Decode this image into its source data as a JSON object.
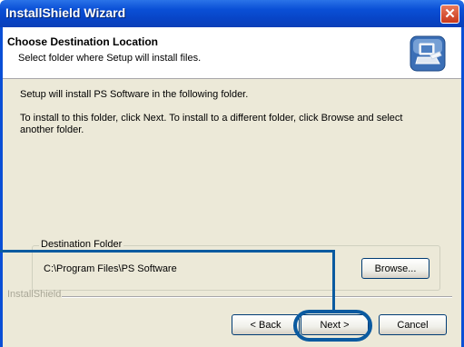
{
  "window": {
    "title": "InstallShield Wizard",
    "close_icon": "close-icon"
  },
  "header": {
    "title": "Choose Destination Location",
    "subtitle": "Select folder where Setup will install files.",
    "icon": "computer-setup-icon"
  },
  "body": {
    "line1": "Setup will install PS Software in the following folder.",
    "line2a": "To install to this folder, click Next. To install to a different folder, click Browse and select",
    "line2b": "another folder."
  },
  "destination": {
    "group_label": "Destination Folder",
    "path": "C:\\Program Files\\PS Software",
    "browse_label": "Browse..."
  },
  "footer": {
    "brand": "InstallShield",
    "back_label": "< Back",
    "next_label": "Next >",
    "cancel_label": "Cancel"
  },
  "colors": {
    "titlebar": "#0a4fd6",
    "dialog": "#ece9d8",
    "annotation": "#0a5aa0"
  }
}
